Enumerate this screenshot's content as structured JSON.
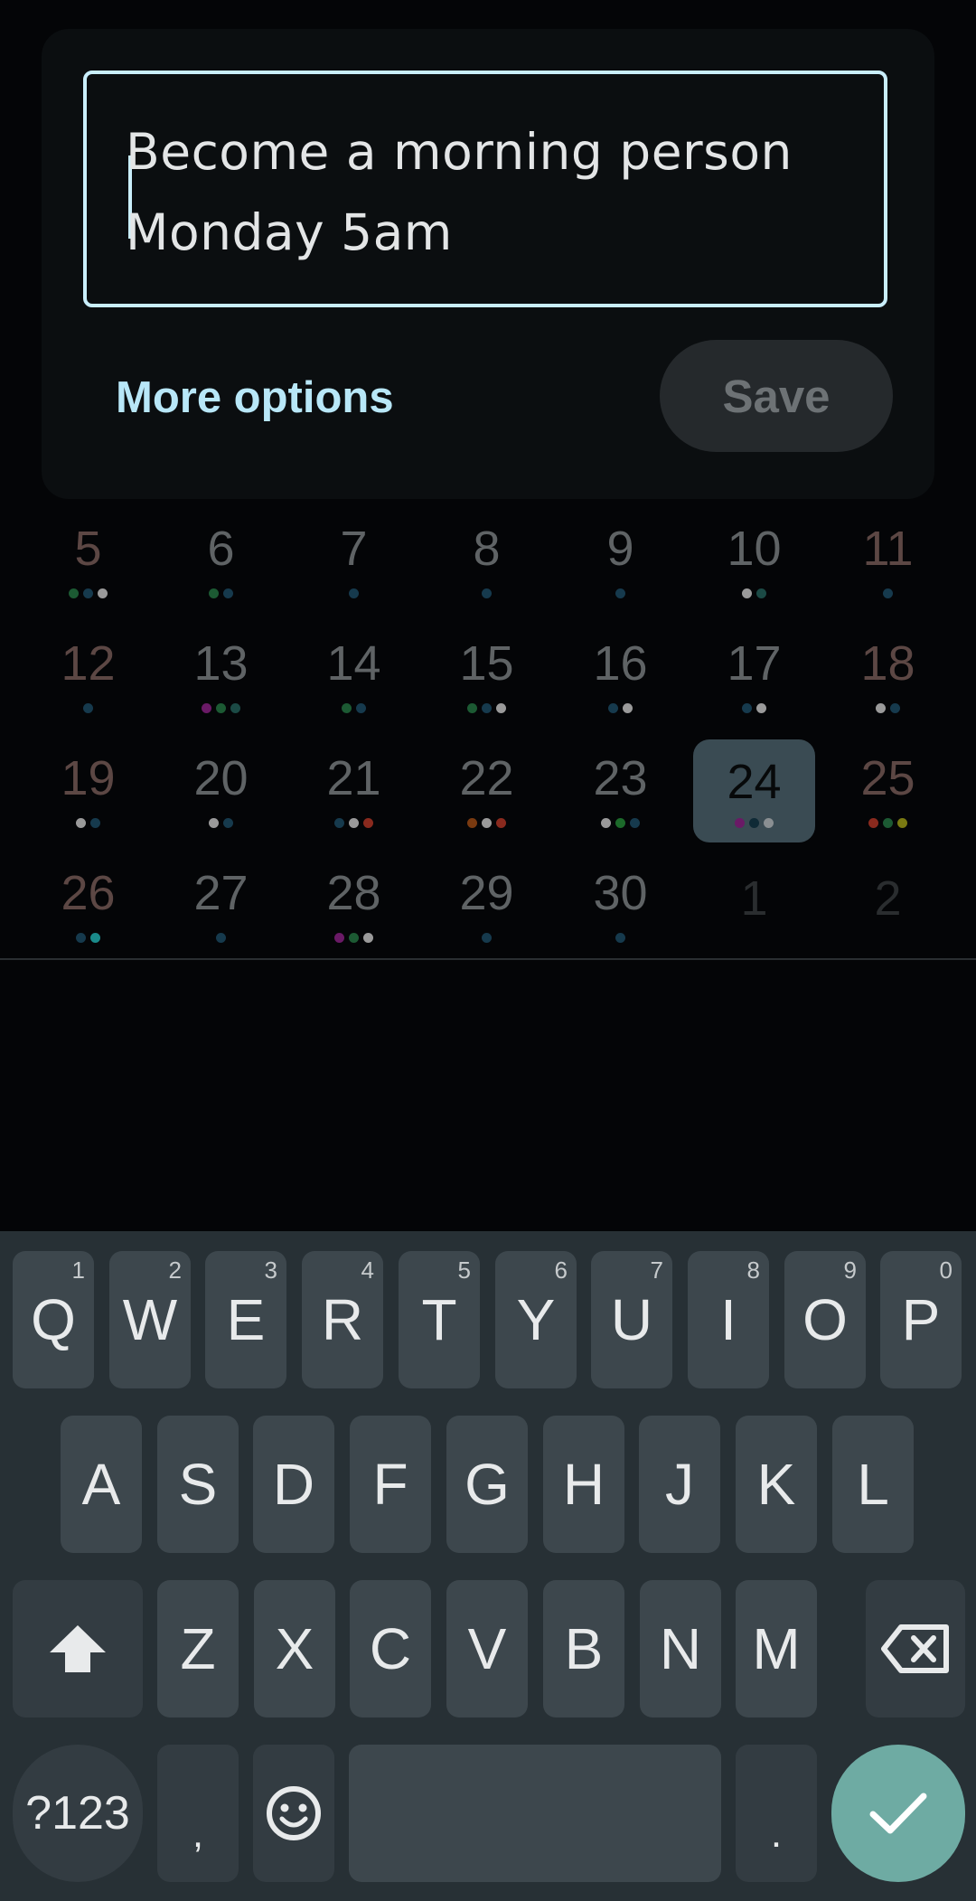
{
  "quick_add": {
    "title_lines": [
      "Become a morning person",
      "Monday 5am"
    ],
    "more_options_label": "More options",
    "save_label": "Save"
  },
  "calendar": {
    "weeks": [
      [
        {
          "day": "5",
          "weekend": true,
          "dots": [
            "#1c5a33",
            "#163a4d",
            "#9a9a9a"
          ]
        },
        {
          "day": "6",
          "dots": [
            "#1c5a33",
            "#163a4d"
          ]
        },
        {
          "day": "7",
          "dots": [
            "#163a4d"
          ]
        },
        {
          "day": "8",
          "dots": [
            "#163a4d"
          ]
        },
        {
          "day": "9",
          "dots": [
            "#163a4d"
          ]
        },
        {
          "day": "10",
          "dots": [
            "#9a9a9a",
            "#1b4a45"
          ]
        },
        {
          "day": "11",
          "weekend": true,
          "dots": [
            "#163a4d"
          ]
        }
      ],
      [
        {
          "day": "12",
          "weekend": true,
          "dots": [
            "#163a4d"
          ]
        },
        {
          "day": "13",
          "dots": [
            "#6a1a66",
            "#1c5a33",
            "#1b4a45"
          ]
        },
        {
          "day": "14",
          "dots": [
            "#1c5a33",
            "#163a4d"
          ]
        },
        {
          "day": "15",
          "dots": [
            "#1c5a33",
            "#163a4d",
            "#9a9a9a"
          ]
        },
        {
          "day": "16",
          "dots": [
            "#163a4d",
            "#9a9a9a"
          ]
        },
        {
          "day": "17",
          "dots": [
            "#163a4d",
            "#9a9a9a"
          ]
        },
        {
          "day": "18",
          "weekend": true,
          "dots": [
            "#9a9a9a",
            "#163a4d"
          ]
        }
      ],
      [
        {
          "day": "19",
          "weekend": true,
          "dots": [
            "#9a9a9a",
            "#163a4d"
          ]
        },
        {
          "day": "20",
          "dots": [
            "#9a9a9a",
            "#163a4d"
          ]
        },
        {
          "day": "21",
          "dots": [
            "#163a4d",
            "#9a9a9a",
            "#8a2a1e"
          ]
        },
        {
          "day": "22",
          "dots": [
            "#7a3a10",
            "#9a9a9a",
            "#8a2a1e"
          ]
        },
        {
          "day": "23",
          "dots": [
            "#9a9a9a",
            "#1c6a2a",
            "#163a4d"
          ]
        },
        {
          "day": "24",
          "today": true,
          "dots": [
            "#6a1a66",
            "#0f2a36",
            "#8a8f92"
          ]
        },
        {
          "day": "25",
          "weekend": true,
          "dots": [
            "#8a2a1e",
            "#1c5a33",
            "#7a7a12"
          ]
        }
      ],
      [
        {
          "day": "26",
          "weekend": true,
          "dots": [
            "#163a4d",
            "#1a8a8a"
          ]
        },
        {
          "day": "27",
          "dots": [
            "#163a4d"
          ]
        },
        {
          "day": "28",
          "dots": [
            "#6a1a66",
            "#1c5a33",
            "#9a9a9a"
          ]
        },
        {
          "day": "29",
          "dots": [
            "#163a4d"
          ]
        },
        {
          "day": "30",
          "dots": [
            "#163a4d"
          ]
        },
        {
          "day": "1",
          "other": true,
          "dots": []
        },
        {
          "day": "2",
          "other": true,
          "dots": []
        }
      ]
    ]
  },
  "keyboard": {
    "row1": [
      {
        "key": "Q",
        "hint": "1"
      },
      {
        "key": "W",
        "hint": "2"
      },
      {
        "key": "E",
        "hint": "3"
      },
      {
        "key": "R",
        "hint": "4"
      },
      {
        "key": "T",
        "hint": "5"
      },
      {
        "key": "Y",
        "hint": "6"
      },
      {
        "key": "U",
        "hint": "7"
      },
      {
        "key": "I",
        "hint": "8"
      },
      {
        "key": "O",
        "hint": "9"
      },
      {
        "key": "P",
        "hint": "0"
      }
    ],
    "row2": [
      "A",
      "S",
      "D",
      "F",
      "G",
      "H",
      "J",
      "K",
      "L"
    ],
    "row3": [
      "Z",
      "X",
      "C",
      "V",
      "B",
      "N",
      "M"
    ],
    "symbols_label": "?123",
    "comma_label": ",",
    "period_label": ".",
    "icons": {
      "shift": "shift-icon",
      "backspace": "backspace-icon",
      "emoji": "emoji-icon",
      "enter": "checkmark-icon"
    },
    "colors": {
      "background": "#273035",
      "key": "#3d474d",
      "enter": "#6eaba3"
    }
  }
}
